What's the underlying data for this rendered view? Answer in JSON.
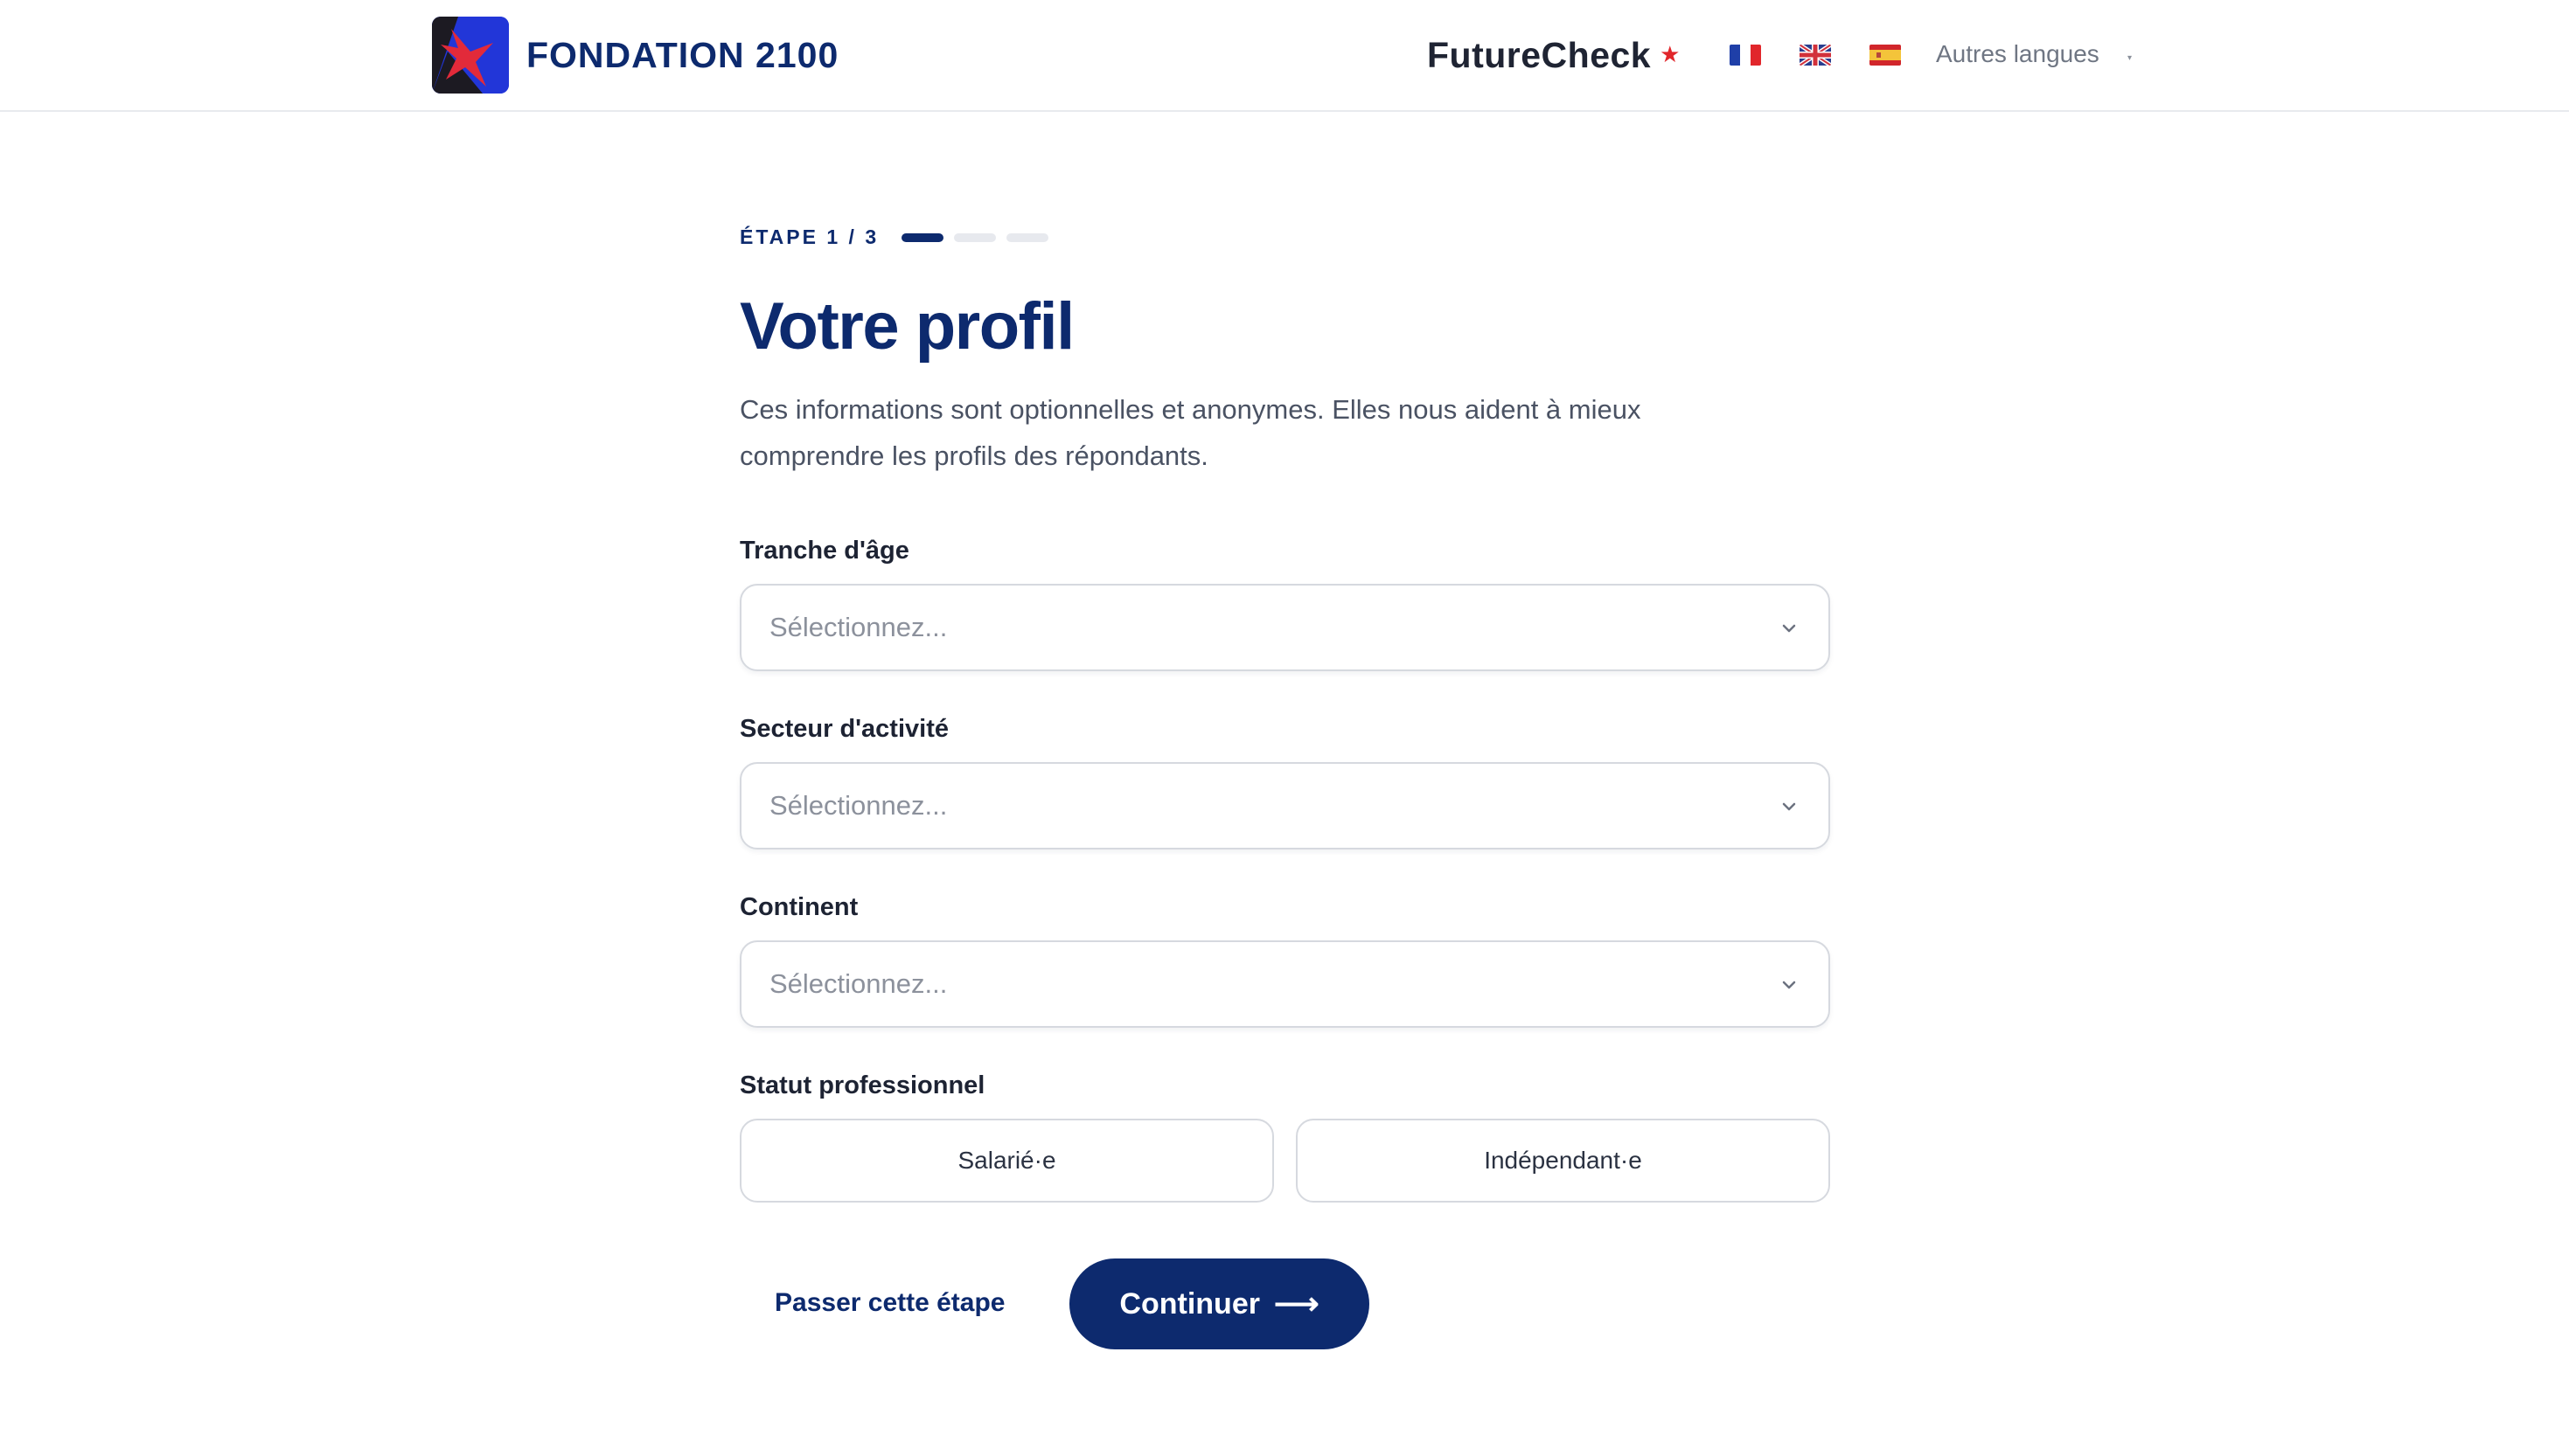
{
  "header": {
    "brand_name": "FONDATION 2100",
    "product_name": "FutureCheck",
    "product_star": "★",
    "flags": [
      {
        "name": "fr-flag-icon",
        "label": "Français"
      },
      {
        "name": "uk-flag-icon",
        "label": "English"
      },
      {
        "name": "es-flag-icon",
        "label": "Español"
      }
    ],
    "other_languages": "Autres langues"
  },
  "progress": {
    "label": "ÉTAPE 1 / 3",
    "current_step": 1,
    "total_steps": 3
  },
  "main": {
    "title": "Votre profil",
    "intro": "Ces informations sont optionnelles et anonymes. Elles nous aident à mieux comprendre les profils des répondants."
  },
  "form": {
    "age": {
      "label": "Tranche d'âge",
      "placeholder": "Sélectionnez..."
    },
    "sector": {
      "label": "Secteur d'activité",
      "placeholder": "Sélectionnez..."
    },
    "continent": {
      "label": "Continent",
      "placeholder": "Sélectionnez..."
    },
    "status": {
      "label": "Statut professionnel",
      "options": [
        "Salarié·e",
        "Indépendant·e"
      ]
    }
  },
  "actions": {
    "skip": "Passer cette étape",
    "continue": "Continuer",
    "continue_arrow": "⟶"
  },
  "colors": {
    "primary": "#0d2a6e",
    "accent_red": "#e1262b",
    "border": "#d6d9df"
  }
}
